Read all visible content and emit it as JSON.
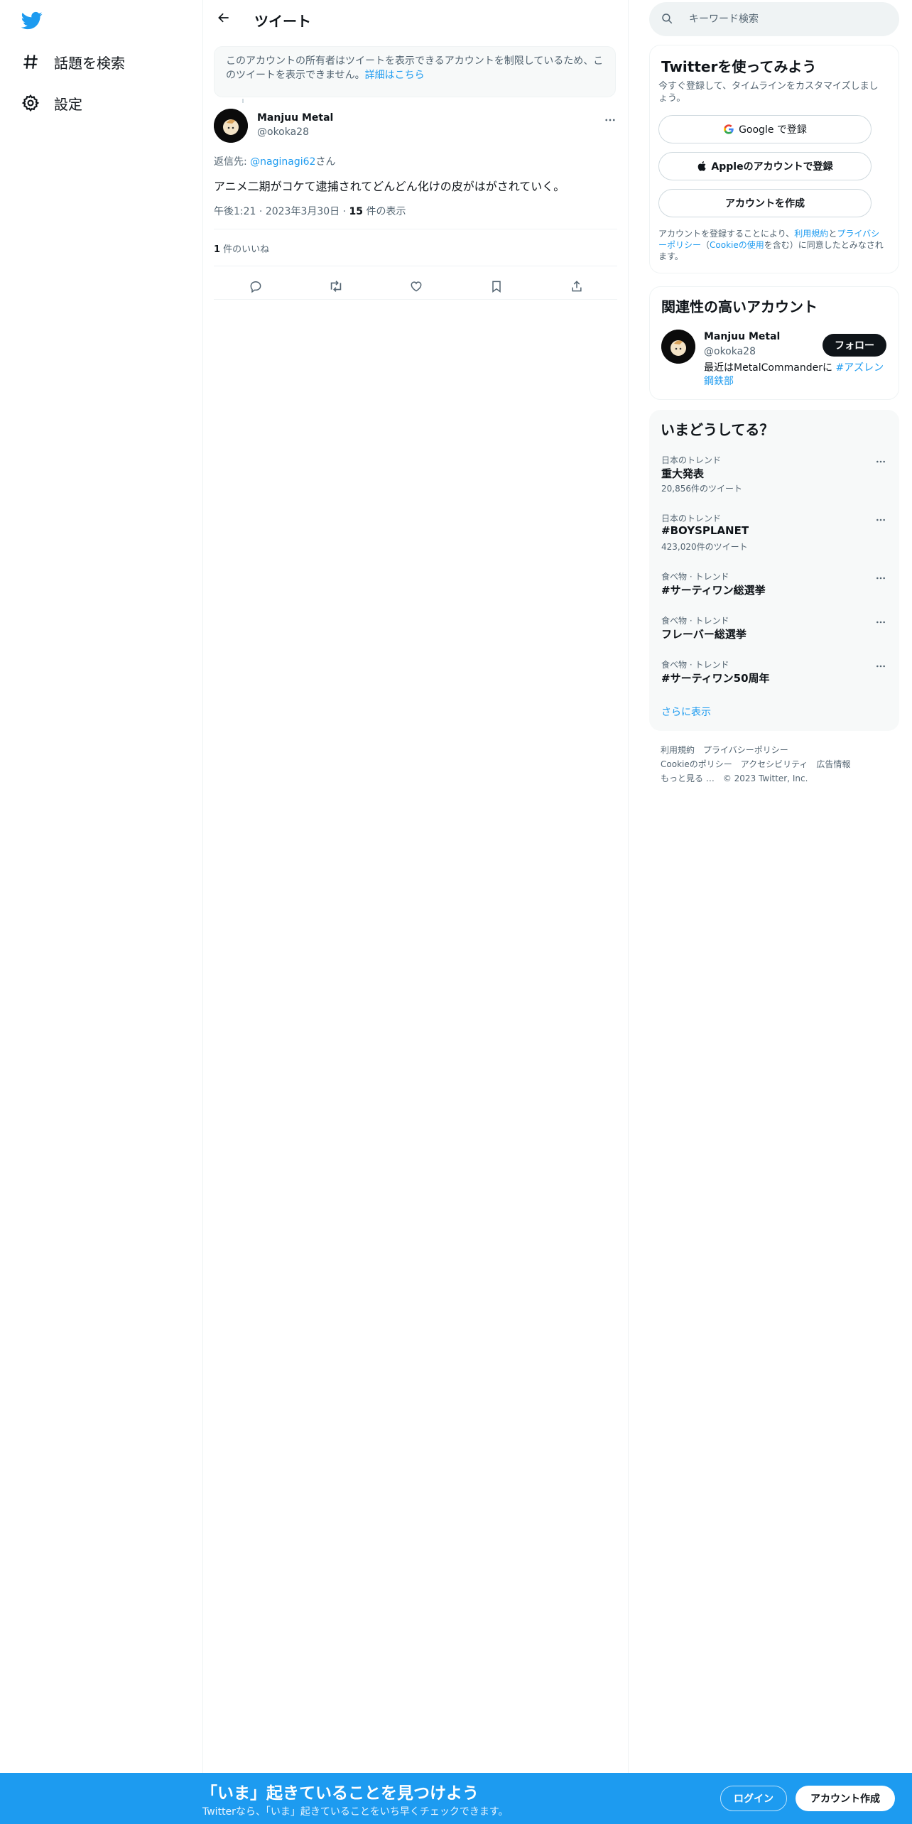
{
  "colors": {
    "accent": "#1d9bf0",
    "text": "#0f1419",
    "muted": "#536471",
    "follow_bg": "#0f1419"
  },
  "left_nav": {
    "logo_icon": "twitter-bird-icon",
    "items": [
      {
        "label": "話題を検索",
        "icon": "hashtag-icon"
      },
      {
        "label": "設定",
        "icon": "gear-icon"
      }
    ]
  },
  "main": {
    "title": "ツイート",
    "notice": {
      "text": "このアカウントの所有者はツイートを表示できるアカウントを制限しているため、このツイートを表示できません。",
      "link": "詳細はこちら"
    },
    "tweet": {
      "name": "Manjuu Metal",
      "handle": "@okoka28",
      "reply_prefix": "返信先: ",
      "reply_to": "@naginagi62",
      "reply_suffix": "さん",
      "text": "アニメ二期がコケて逮捕されてどんどん化けの皮がはがされていく。",
      "time": "午後1:21",
      "date": "2023年3月30日",
      "views_count": "15",
      "views_label": " 件の表示",
      "likes_count": "1",
      "likes_label": " 件のいいね",
      "actions": [
        "reply-icon",
        "retweet-icon",
        "like-icon",
        "bookmark-icon",
        "share-icon"
      ]
    }
  },
  "right": {
    "search": {
      "placeholder": "キーワード検索"
    },
    "signup": {
      "title": "Twitterを使ってみよう",
      "subtitle": "今すぐ登録して、タイムラインをカスタマイズしましょう。",
      "google": "Google で登録",
      "apple": "Appleのアカウントで登録",
      "create": "アカウントを作成",
      "legal_1": "アカウントを登録することにより、",
      "legal_terms": "利用規約",
      "legal_and": "と",
      "legal_privacy": "プライバシーポリシー",
      "legal_paren_open": "（",
      "legal_cookie": "Cookieの使用",
      "legal_2": "を含む）に同意したとみなされます。"
    },
    "related": {
      "title": "関連性の高いアカウント",
      "name": "Manjuu Metal",
      "handle": "@okoka28",
      "bio_text": "最近はMetalCommanderに ",
      "bio_tag": "#アズレン鋼鉄部",
      "follow": "フォロー"
    },
    "trends": {
      "title": "いまどうしてる？",
      "items": [
        {
          "context": "日本のトレンド",
          "name": "重大発表",
          "count": "20,856件のツイート"
        },
        {
          "context": "日本のトレンド",
          "name": "#BOYSPLANET",
          "count": "423,020件のツイート"
        },
        {
          "context": "食べ物 · トレンド",
          "name": "#サーティワン総選挙",
          "count": ""
        },
        {
          "context": "食べ物 · トレンド",
          "name": "フレーバー総選挙",
          "count": ""
        },
        {
          "context": "食べ物 · トレンド",
          "name": "#サーティワン50周年",
          "count": ""
        }
      ],
      "show_more": "さらに表示"
    },
    "footer": {
      "links": [
        "利用規約",
        "プライバシーポリシー",
        "Cookieのポリシー",
        "アクセシビリティ",
        "広告情報",
        "もっと見る …",
        "© 2023 Twitter, Inc."
      ]
    }
  },
  "bottom_bar": {
    "title": "「いま」起きていることを見つけよう",
    "subtitle": "Twitterなら、「いま」起きていることをいち早くチェックできます。",
    "login": "ログイン",
    "signup": "アカウント作成"
  }
}
